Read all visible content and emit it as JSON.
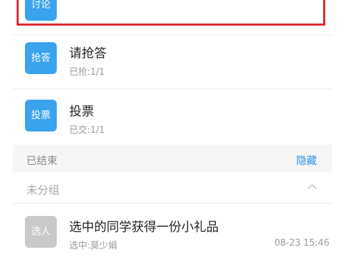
{
  "items_active": [
    {
      "icon_label": "讨论",
      "title": "",
      "sub": "",
      "icon_color": "#3aa3ee",
      "selected": true
    },
    {
      "icon_label": "抢答",
      "title": "请抢答",
      "sub": "已抢:1/1",
      "icon_color": "#3aa3ee"
    },
    {
      "icon_label": "投票",
      "title": "投票",
      "sub": "已交:1/1",
      "icon_color": "#3aa3ee"
    }
  ],
  "section_ended": {
    "title": "已结束",
    "action": "隐藏"
  },
  "group": {
    "title": "未分组",
    "chevron_icon": "chevron-up-icon"
  },
  "items_ended": [
    {
      "icon_label": "选人",
      "title": "选中的同学获得一份小礼品",
      "sub": "选中:莫少娟",
      "time": "08-23 15:46",
      "icon_color": "#c9c9c9"
    }
  ],
  "colors": {
    "selection_border": "#e0262e",
    "accent": "#2f8fe6"
  }
}
